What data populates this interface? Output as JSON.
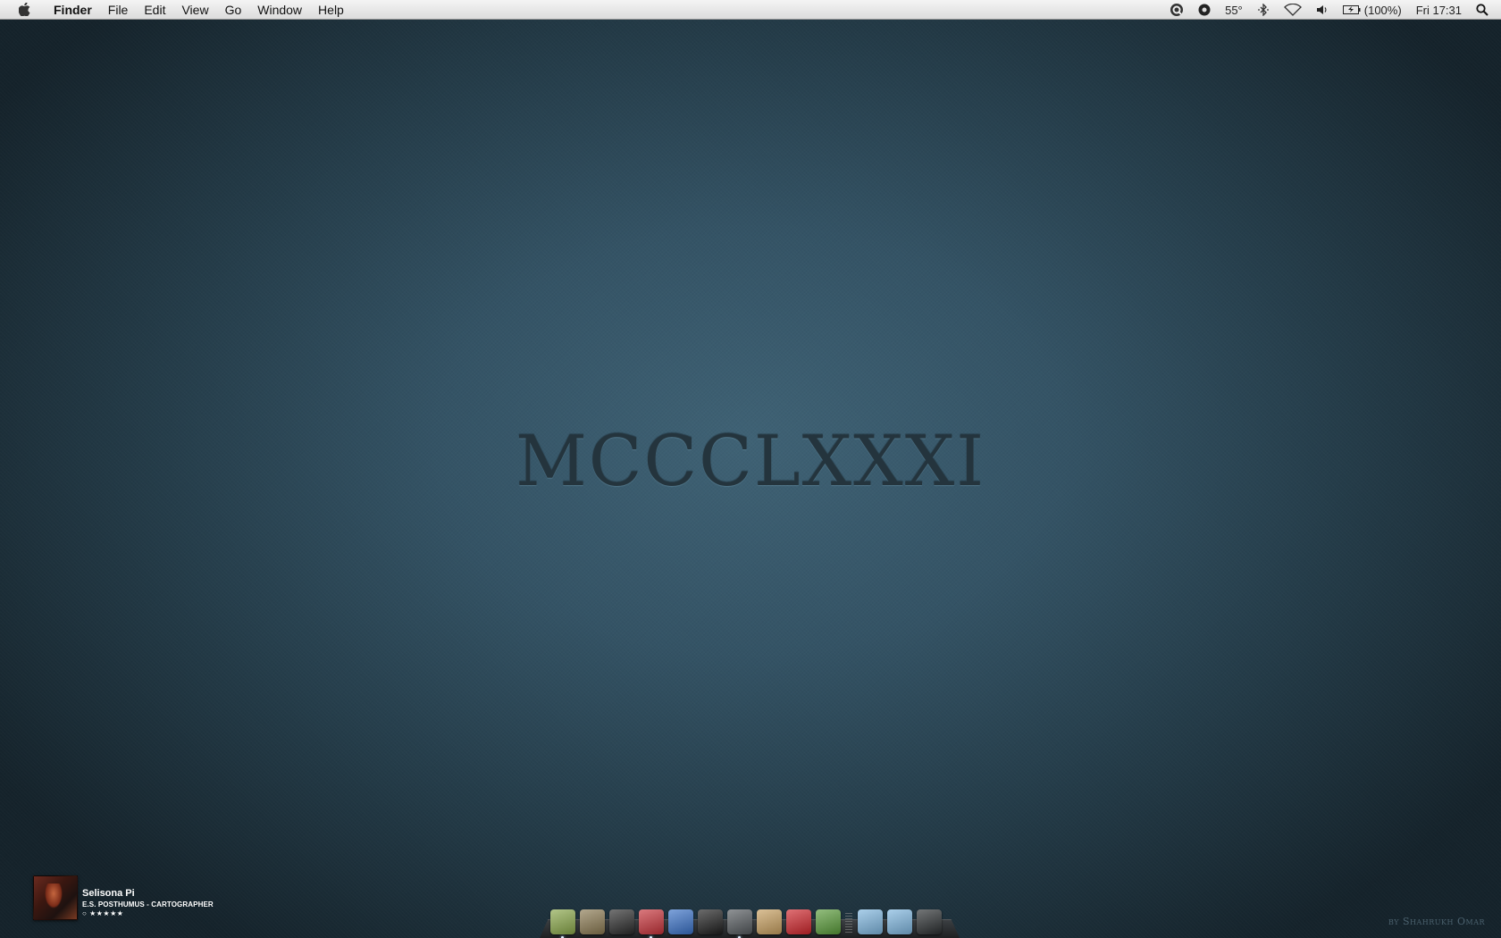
{
  "menubar": {
    "app_name": "Finder",
    "menus": [
      "File",
      "Edit",
      "View",
      "Go",
      "Window",
      "Help"
    ],
    "status": {
      "temperature": "55°",
      "battery": "(100%)",
      "clock": "Fri 17:31"
    },
    "icons": [
      "quicksilver-icon",
      "record-icon",
      "temperature-label",
      "bluetooth-icon",
      "wifi-icon",
      "volume-icon",
      "battery-icon",
      "spotlight-icon"
    ]
  },
  "desktop": {
    "numeral": "MCCCLXXXI",
    "signature": "by Shahrukh Omar"
  },
  "now_playing": {
    "title": "Selisona Pi",
    "artist": "E.S. POSTHUMUS - CARTOGRAPHER",
    "rating_prefix": "○",
    "rating": "★★★★★"
  },
  "dock": {
    "apps": [
      {
        "name": "snail-app-icon",
        "color": "#8aa84a",
        "running": true
      },
      {
        "name": "box-app-icon",
        "color": "#8b7a52",
        "running": false
      },
      {
        "name": "robot-app-icon",
        "color": "#2b2b2b",
        "running": false
      },
      {
        "name": "umbrella-app-icon",
        "color": "#c8333a",
        "running": true
      },
      {
        "name": "pencil-app-icon",
        "color": "#3a72c8",
        "running": false
      },
      {
        "name": "notepad-app-icon",
        "color": "#1e1e1e",
        "running": false
      },
      {
        "name": "speaker-app-icon",
        "color": "#555a5e",
        "running": true
      },
      {
        "name": "brush-app-icon",
        "color": "#c8a060",
        "running": false
      },
      {
        "name": "swiss-knife-app-icon",
        "color": "#d0262c",
        "running": false
      },
      {
        "name": "leaf-app-icon",
        "color": "#5a9c3a",
        "running": false
      }
    ],
    "stacks": [
      {
        "name": "downloads-folder-icon",
        "color": "#7fb7e0"
      },
      {
        "name": "applications-folder-icon",
        "color": "#7fb7e0"
      },
      {
        "name": "trash-icon",
        "color": "#2a2e30"
      }
    ]
  }
}
